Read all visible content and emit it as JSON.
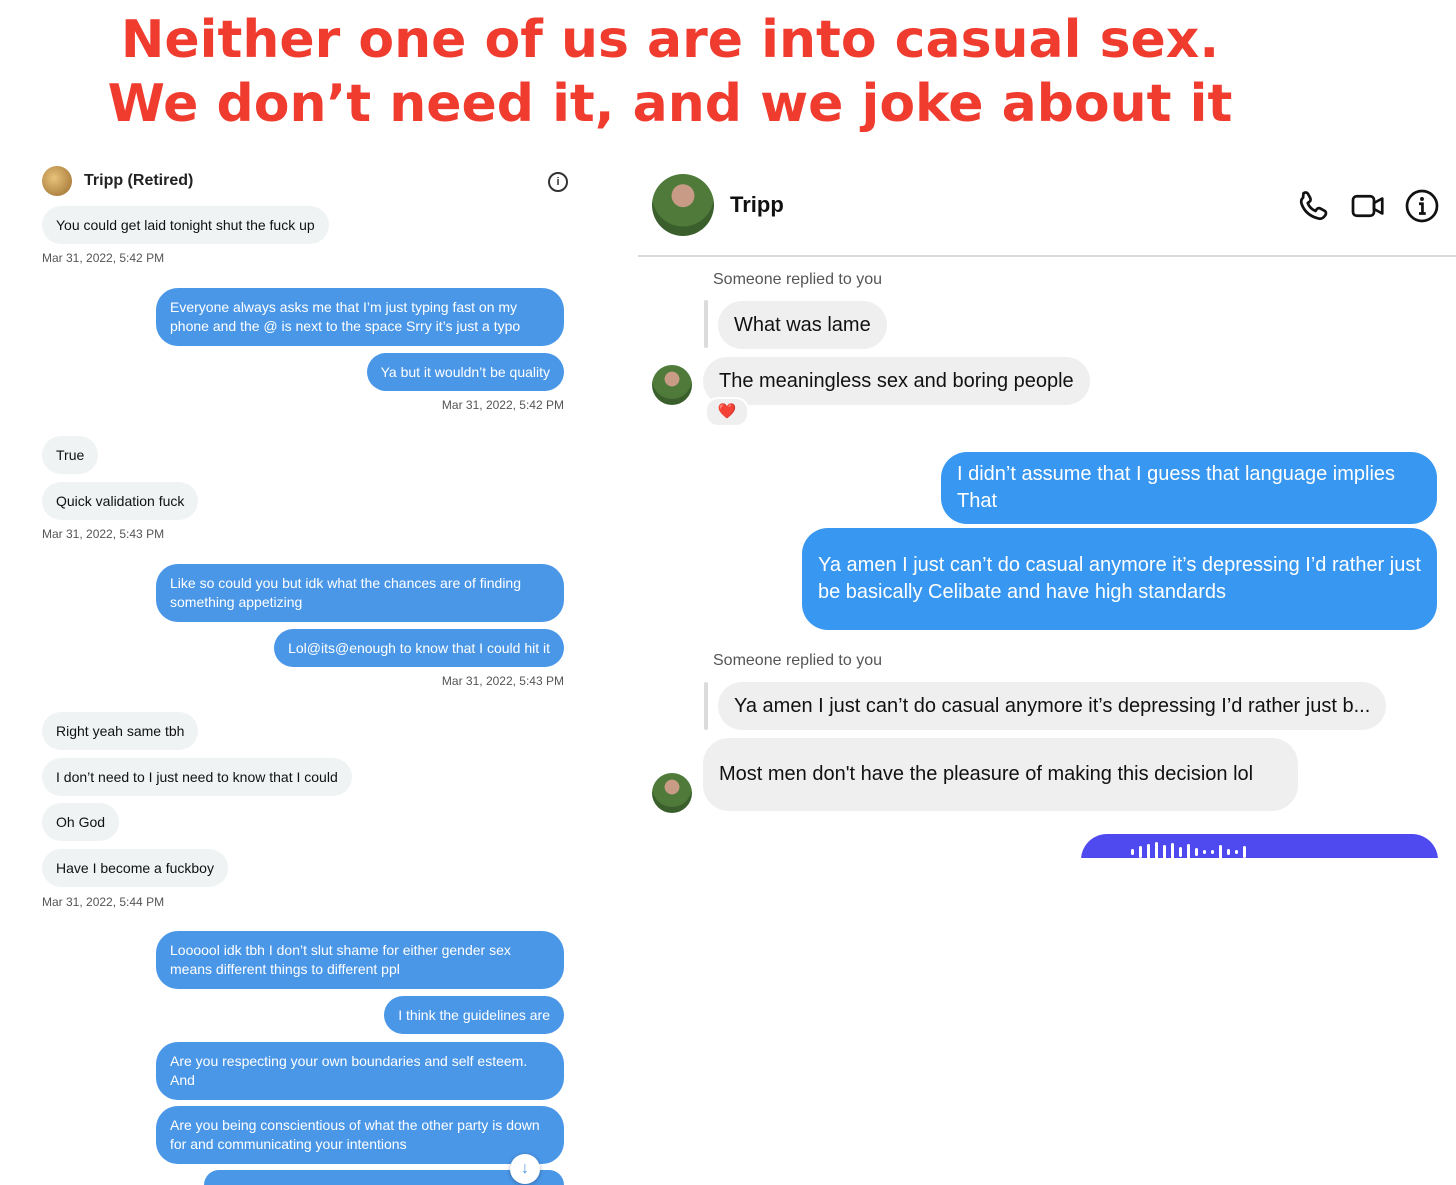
{
  "caption": {
    "line1": "Neither one of us are into casual sex.",
    "line2": "We don’t need it, and we joke about it"
  },
  "left_chat": {
    "contact_name": "Tripp (Retired)",
    "info_icon": "info-icon",
    "scroll_icon": "arrow-down-icon",
    "messages": [
      {
        "dir": "in",
        "text": "You could get laid tonight shut the fuck up"
      },
      {
        "time": "Mar 31, 2022, 5:42 PM"
      },
      {
        "dir": "out",
        "text": "Everyone always asks me that I’m just typing fast on my phone and the @ is next to the space Srry it’s just a typo"
      },
      {
        "dir": "out",
        "text": "Ya but it wouldn’t be quality"
      },
      {
        "time": "Mar 31, 2022, 5:42 PM"
      },
      {
        "dir": "in",
        "text": "True"
      },
      {
        "dir": "in",
        "text": "Quick validation fuck"
      },
      {
        "time": "Mar 31, 2022, 5:43 PM"
      },
      {
        "dir": "out",
        "text": "Like so could you but idk what the chances are of finding something appetizing"
      },
      {
        "dir": "out",
        "text": "Lol@its@enough to know that I could hit it"
      },
      {
        "time": "Mar 31, 2022, 5:43 PM"
      },
      {
        "dir": "in",
        "text": "Right yeah same tbh"
      },
      {
        "dir": "in",
        "text": "I don’t need to I just need to know that I could"
      },
      {
        "dir": "in",
        "text": "Oh God"
      },
      {
        "dir": "in",
        "text": "Have I become a fuckboy"
      },
      {
        "time": "Mar 31, 2022, 5:44 PM"
      },
      {
        "dir": "out",
        "text": "Loooool idk tbh I don’t slut shame for either gender sex means different things to different ppl"
      },
      {
        "dir": "out",
        "text": "I think the guidelines are"
      },
      {
        "dir": "out",
        "text": "Are you respecting your own boundaries and self esteem. And"
      },
      {
        "dir": "out",
        "text": "Are you being conscientious of what the other party is down for and communicating your intentions"
      }
    ]
  },
  "right_chat": {
    "contact_name": "Tripp",
    "icons": [
      "phone-icon",
      "video-icon",
      "info-icon"
    ],
    "reply_label_1": "Someone replied to you",
    "quoted_1": "What was lame",
    "msg_1": "The meaningless sex and boring people",
    "reaction": "❤️",
    "out_1": "I didn’t assume that I guess that language implies That",
    "out_2": "Ya amen I just can’t do casual anymore it’s depressing I’d rather just be basically Celibate and have high standards",
    "reply_label_2": "Someone replied to you",
    "quoted_2": "Ya amen I just can’t do casual anymore it’s depressing I’d rather just b...",
    "msg_2": "Most men don't have the pleasure of making this decision lol",
    "colors": {
      "outgoing": "#3897f0",
      "incoming": "#efefef",
      "voice": "#4f4af0"
    }
  }
}
